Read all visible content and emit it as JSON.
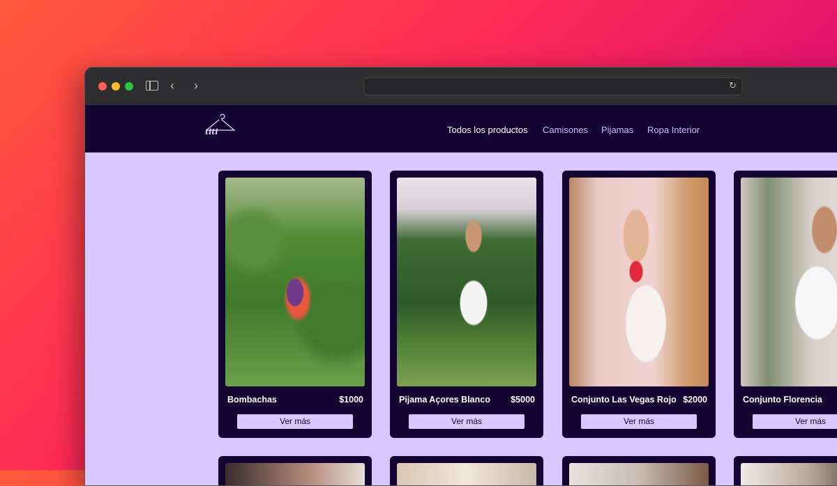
{
  "browser": {
    "url": "",
    "icons": {
      "sidebar": "sidebar-icon",
      "back": "chevron-left-icon",
      "forward": "chevron-right-icon",
      "reload": "reload-icon"
    }
  },
  "site": {
    "logo_text": "titi",
    "nav": [
      {
        "label": "Todos los productos",
        "active": true
      },
      {
        "label": "Camisones",
        "active": false
      },
      {
        "label": "Pijamas",
        "active": false
      },
      {
        "label": "Ropa Interior",
        "active": false
      }
    ],
    "products": [
      {
        "name": "Bombachas",
        "price": "$1000",
        "button": "Ver más"
      },
      {
        "name": "Pijama Açores Blanco",
        "price": "$5000",
        "button": "Ver más"
      },
      {
        "name": "Conjunto Las Vegas Rojo",
        "price": "$2000",
        "button": "Ver más"
      },
      {
        "name": "Conjunto Florencia",
        "price": "",
        "button": "Ver más"
      }
    ]
  },
  "colors": {
    "navbar_bg": "#140533",
    "page_bg": "#dcc6ff",
    "card_bg": "#140533",
    "nav_link": "#cdb6ff",
    "button_bg": "#dcc6ff"
  }
}
